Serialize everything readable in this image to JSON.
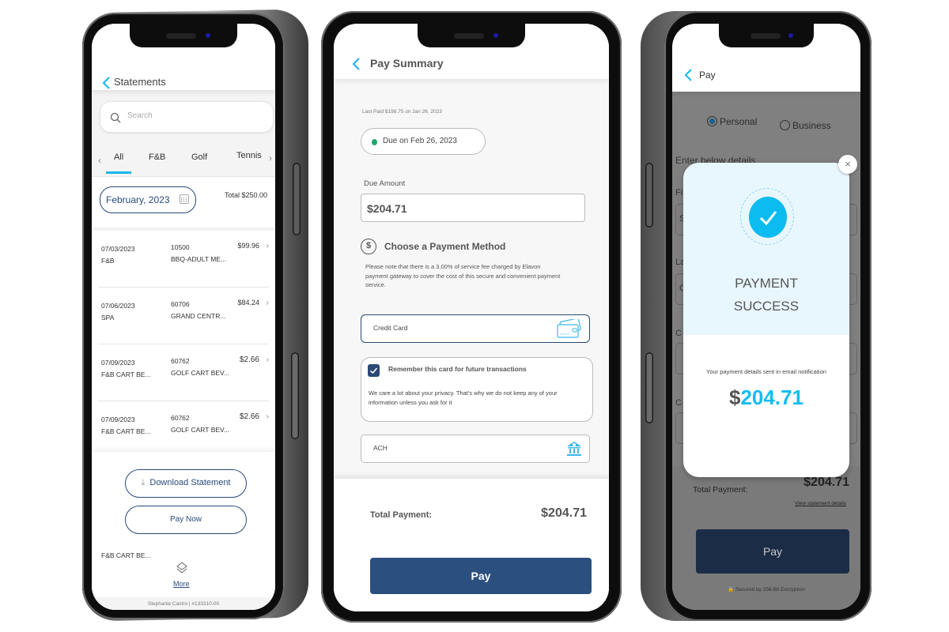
{
  "colors": {
    "accent_blue": "#18b5ec",
    "navy": "#284a7a",
    "pay_button": "#2b4f7e",
    "status_green": "#1fa86a",
    "success_cyan": "#0cbcf0"
  },
  "statements": {
    "header": {
      "title": "Statements",
      "back_icon": "chevron-left-icon"
    },
    "search": {
      "placeholder": "Search",
      "icon": "search-icon"
    },
    "tabs": [
      {
        "label": "All",
        "active": true
      },
      {
        "label": "F&B",
        "active": false
      },
      {
        "label": "Golf",
        "active": false
      },
      {
        "label": "Tennis",
        "active": false
      }
    ],
    "tab_prev": "‹",
    "tab_next": "›",
    "month": "February, 2023",
    "total": "Total  $250.00",
    "rows": [
      {
        "date": "07/03/2023",
        "category": "F&B",
        "code": "10500",
        "desc": "BBQ-ADULT ME...",
        "amount": "$99.96"
      },
      {
        "date": "07/06/2023",
        "category": "SPA",
        "code": "60706",
        "desc": "GRAND CENTR...",
        "amount": "$84.24"
      },
      {
        "date": "07/09/2023",
        "category": "F&B CART BE...",
        "code": "60762",
        "desc": "GOLF CART BEV...",
        "amount": "$2.66"
      },
      {
        "date": "07/09/2023",
        "category": "F&B CART BE...",
        "code": "60762",
        "desc": "GOLF CART BEV...",
        "amount": "$2.66"
      }
    ],
    "row_chevron": "›",
    "download_label": "Download Statement",
    "download_icon": "⤓",
    "pay_now_label": "Pay Now",
    "truncated_text": "F&B CART BE...",
    "more_label": "More",
    "user_line": "Stephanie Castro | #133310-00"
  },
  "pay_summary": {
    "header": {
      "title": "Pay Summary"
    },
    "last_paid": "Last Paid $198.75 on Jan 26, 2023",
    "due_on": "Due on Feb 26, 2023",
    "due_amount_label": "Due Amount",
    "due_amount_value": "$204.71",
    "method_icon": "$",
    "method_title": "Choose a Payment Method",
    "note": "Please note that there is a 3.00% of service fee charged by Elavon payment gateway to cover the cost of this secure and convenient payment service.",
    "credit_card_label": "Credit Card",
    "remember_label": "Remember this card for future transactions",
    "remember_checked": true,
    "privacy_text": "We care a lot about your privacy.  That's why we do not keep any of your information unless you ask for it",
    "ach_label": "ACH",
    "total_label": "Total Payment:",
    "total_value": "$204.71",
    "pay_label": "Pay"
  },
  "pay_success": {
    "header": {
      "title": "Pay"
    },
    "account_types": [
      {
        "label": "Personal",
        "selected": true
      },
      {
        "label": "Business",
        "selected": false
      }
    ],
    "form_heading": "Enter below details",
    "field_labels": [
      "Fi",
      "La",
      "C",
      "C"
    ],
    "field_values": [
      "S",
      "C",
      "",
      ""
    ],
    "modal": {
      "close_label": "×",
      "title_line1": "PAYMENT",
      "title_line2": "SUCCESS",
      "message": "Your payment details sent in email notification",
      "currency": "$",
      "amount": "204.71"
    },
    "total_label": "Total Payment:",
    "total_value": "$204.71",
    "view_link": "View statement details",
    "pay_label": "Pay",
    "secured_text": "🔒 Secured by 256-Bit Encryption"
  }
}
